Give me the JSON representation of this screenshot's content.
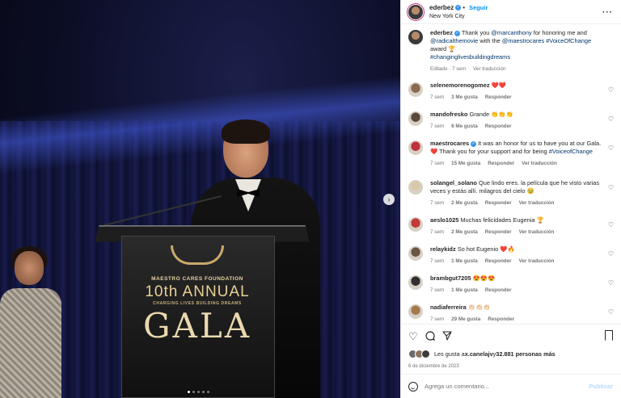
{
  "post": {
    "author": "ederbez",
    "follow_label": "Seguir",
    "separator": "•",
    "location": "New York City",
    "more_icon": "more-horizontal-icon"
  },
  "image": {
    "sign": {
      "org": "MAESTRO CARES FOUNDATION",
      "annual": "10th ANNUAL",
      "subtitle": "CHARGING LIVES BUILDING DREAMS",
      "gala": "GALA"
    },
    "next_icon": "chevron-right-icon",
    "slide_count": 5,
    "active_slide": 1
  },
  "caption": {
    "user": "ederbez",
    "text_1": " Thank you ",
    "mention_1": "@marcanthony",
    "text_2": " for honoring me and ",
    "mention_2": "@radicalthemovie",
    "text_3": " with the ",
    "mention_3": "@maestrocares",
    "text_4": " ",
    "hashtag_1": "#VoiceOfChange",
    "text_5": " award 🏆",
    "hashtag_2": "#changinglivesbuildingdreams",
    "edited": "Editado · 7 sem",
    "translate": "Ver traducción"
  },
  "comments": [
    {
      "user": "selenemorenogomez",
      "text": " ❤️❤️",
      "time": "7 sem",
      "likes": "3 Me gusta",
      "reply": "Responder",
      "translate": "",
      "avatar_color": "#8a6a52"
    },
    {
      "user": "mandofresko",
      "text": " Grande 👏👏👏",
      "time": "7 sem",
      "likes": "6 Me gusta",
      "reply": "Responder",
      "translate": "",
      "avatar_color": "#5b4a3c"
    },
    {
      "user": "maestrocares",
      "text": " It was an honor for us to have you at our Gala. ❤️ Thank you for your support and for being ",
      "hashtag": "#VoiceofChange",
      "time": "7 sem",
      "likes": "15 Me gusta",
      "reply": "Responder",
      "translate": "Ver traducción",
      "avatar_color": "#c0303d"
    },
    {
      "user": "solangel_solano",
      "text": " Que lindo eres. la película que he visto varias veces y estás allí. milagros del cielo 🥹",
      "time": "7 sem",
      "likes": "2 Me gusta",
      "reply": "Responder",
      "translate": "Ver traducción",
      "avatar_color": "#d9c9a8"
    },
    {
      "user": "aeslo1025",
      "text": " Muchas felicidades Eugenia 🏆",
      "time": "7 sem",
      "likes": "2 Me gusta",
      "reply": "Responder",
      "translate": "Ver traducción",
      "avatar_color": "#c23a3a"
    },
    {
      "user": "relaykidz",
      "text": " So hot Eugenio ❤️🔥",
      "time": "7 sem",
      "likes": "1 Me gusta",
      "reply": "Responder",
      "translate": "Ver traducción",
      "avatar_color": "#6b5443"
    },
    {
      "user": "brambgut7205",
      "text": " 😍😍😍",
      "time": "7 sem",
      "likes": "1 Me gusta",
      "reply": "Responder",
      "translate": "",
      "avatar_color": "#2f2f2f"
    },
    {
      "user": "nadiaferreira",
      "text": " 👏🏻👏🏻👏🏻",
      "time": "7 sem",
      "likes": "29 Me gusta",
      "reply": "Responder",
      "translate": "",
      "avatar_color": "#a7794f"
    }
  ],
  "actions": {
    "like_icon": "heart-icon",
    "comment_icon": "comment-icon",
    "share_icon": "send-icon",
    "save_icon": "bookmark-icon"
  },
  "likes": {
    "text_1": "Les gusta a ",
    "user": "x.canelajv",
    "text_2": " y ",
    "count": "32.881 personas más"
  },
  "date": "6 de diciembre de 2023",
  "composer": {
    "placeholder": "Agrega un comentario...",
    "publish": "Publicar",
    "emoji_icon": "emoji-icon"
  },
  "colors": {
    "accent": "#0095f6",
    "verified": "#3897f0",
    "mention": "#00376b",
    "muted": "#737373"
  }
}
